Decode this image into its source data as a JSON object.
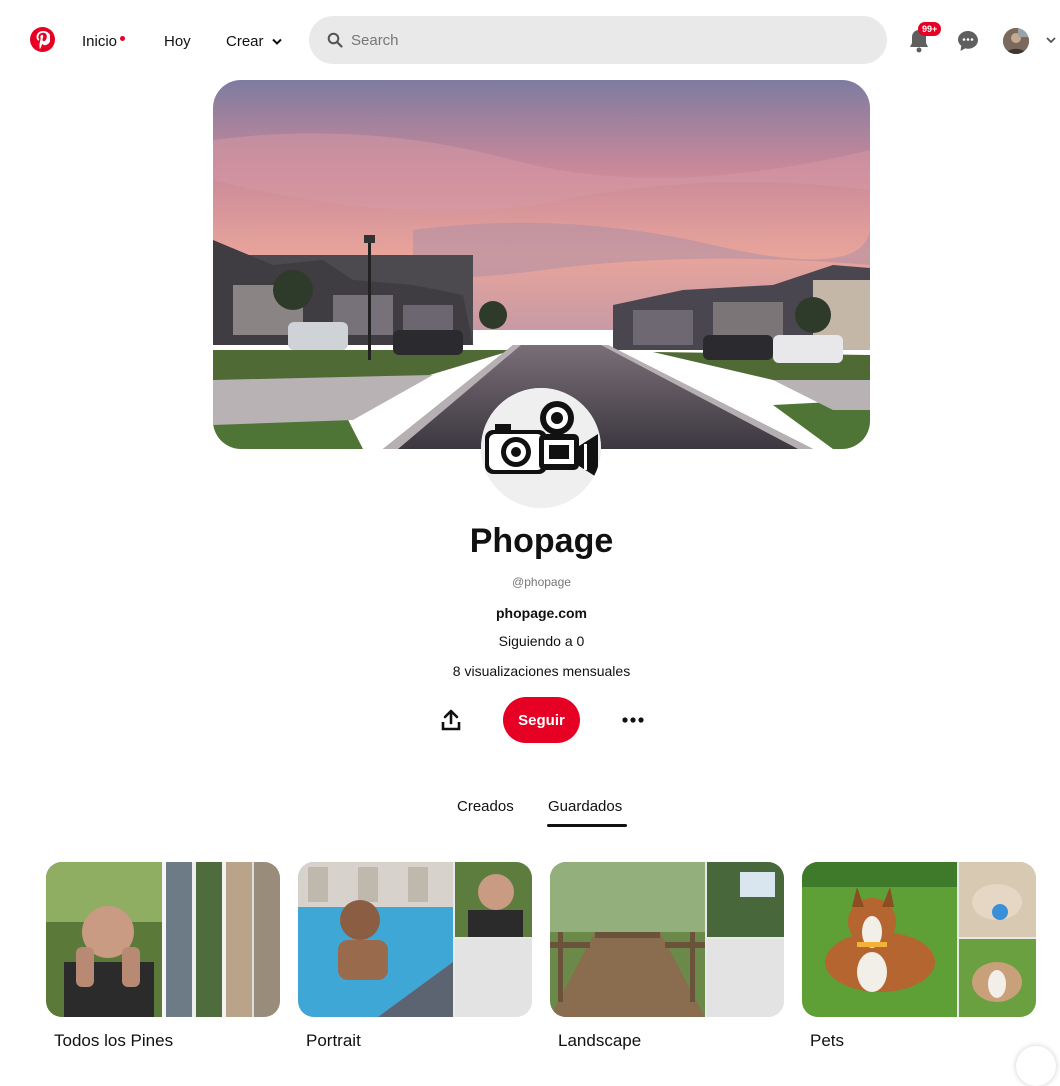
{
  "header": {
    "nav": [
      {
        "label": "Inicio"
      },
      {
        "label": "Hoy"
      },
      {
        "label": "Crear"
      }
    ],
    "search_placeholder": "Search",
    "notifications_badge": "99+"
  },
  "profile": {
    "name": "Phopage",
    "handle": "@phopage",
    "website": "phopage.com",
    "following": "Siguiendo a 0",
    "monthly_views": "8 visualizaciones mensuales",
    "follow_label": "Seguir"
  },
  "tabs": [
    {
      "label": "Creados",
      "active": false
    },
    {
      "label": "Guardados",
      "active": true
    }
  ],
  "boards": [
    {
      "title": "Todos los Pines"
    },
    {
      "title": "Portrait"
    },
    {
      "title": "Landscape"
    },
    {
      "title": "Pets"
    }
  ],
  "colors": {
    "brand": "#e60023",
    "text": "#111111",
    "muted": "#767676",
    "search_bg": "#e9e9e9"
  },
  "icons": [
    "pinterest-logo-icon",
    "chevron-down-icon",
    "search-icon",
    "bell-icon",
    "chat-icon",
    "share-icon",
    "more-icon"
  ]
}
